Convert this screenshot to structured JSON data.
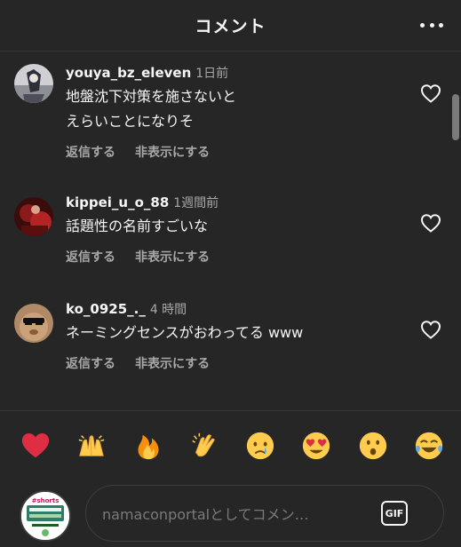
{
  "header": {
    "title": "コメント",
    "more_icon": "more-horizontal-icon"
  },
  "comments": [
    {
      "username": "youya_bz_eleven",
      "time": "1日前",
      "lines": [
        "地盤沈下対策を施さないと",
        "えらいことになりそ"
      ],
      "reply_label": "返信する",
      "hide_label": "非表示にする"
    },
    {
      "username": "kippei_u_o_88",
      "time": "1週間前",
      "lines": [
        "話題性の名前すごいな"
      ],
      "reply_label": "返信する",
      "hide_label": "非表示にする"
    },
    {
      "username": "ko_0925_._",
      "time": "4 時間",
      "lines": [
        "ネーミングセンスがおわってる www"
      ],
      "reply_label": "返信する",
      "hide_label": "非表示にする"
    }
  ],
  "emojis": [
    "red-heart",
    "raising-hands",
    "fire",
    "clapping-hands",
    "crying-face",
    "heart-eyes",
    "surprised-face",
    "tears-of-joy"
  ],
  "composer": {
    "placeholder": "namaconportalとしてコメン…",
    "gif_label": "GIF",
    "avatar_text": "#shorts"
  },
  "colors": {
    "background": "#262626",
    "text": "#f5f5f5",
    "muted": "#a8a8a8",
    "heart_red": "#ed4956"
  }
}
